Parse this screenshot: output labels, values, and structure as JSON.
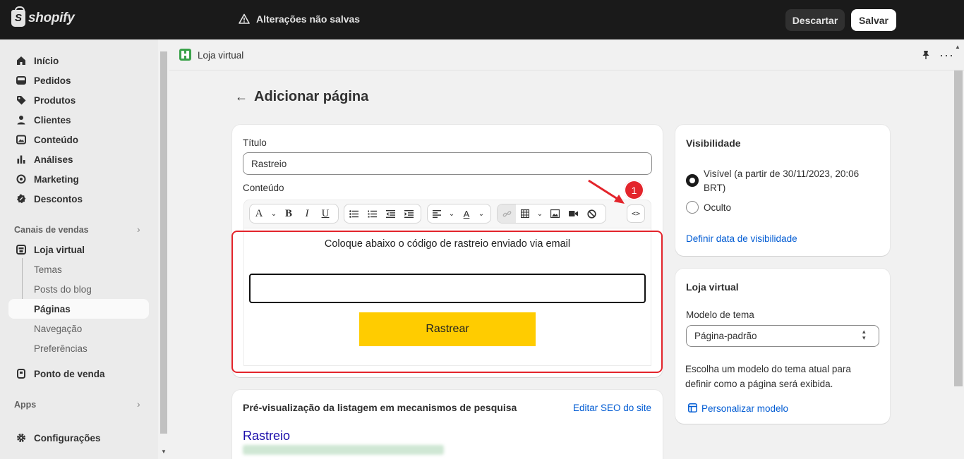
{
  "topbar": {
    "logo_text": "shopify",
    "unsaved_text": "Alterações não salvas",
    "discard_label": "Descartar",
    "save_label": "Salvar",
    "bg_color": "#1a1a1a"
  },
  "sidebar": {
    "items": [
      {
        "label": "Início",
        "icon": "home-icon"
      },
      {
        "label": "Pedidos",
        "icon": "inbox-icon"
      },
      {
        "label": "Produtos",
        "icon": "tag-icon"
      },
      {
        "label": "Clientes",
        "icon": "person-icon"
      },
      {
        "label": "Conteúdo",
        "icon": "image-icon"
      },
      {
        "label": "Análises",
        "icon": "bar-chart-icon"
      },
      {
        "label": "Marketing",
        "icon": "target-icon"
      },
      {
        "label": "Descontos",
        "icon": "discount-icon"
      }
    ],
    "sales_channels_label": "Canais de vendas",
    "store_label": "Loja virtual",
    "store_subitems": [
      "Temas",
      "Posts do blog",
      "Páginas",
      "Navegação",
      "Preferências"
    ],
    "active_subitem": "Páginas",
    "pos_label": "Ponto de venda",
    "apps_label": "Apps",
    "settings_label": "Configurações"
  },
  "breadcrumb": {
    "store_name": "Loja virtual"
  },
  "page": {
    "title": "Adicionar página"
  },
  "content_card": {
    "title_label": "Título",
    "title_value": "Rastreio",
    "content_label": "Conteúdo",
    "editor_caption": "Coloque abaixo o código de rastreio enviado via email",
    "track_button": "Rastrear",
    "track_button_color": "#ffcc00",
    "code_button": "<>",
    "annotation_number": "1",
    "annotation_color": "#e3242b"
  },
  "toolbar": {
    "font": "A",
    "bold": "B",
    "italic": "I",
    "underline": "U",
    "text_color": "A"
  },
  "seo_card": {
    "title": "Pré-visualização da listagem em mecanismos de pesquisa",
    "edit_link": "Editar SEO do site",
    "preview_title": "Rastreio"
  },
  "visibility_card": {
    "title": "Visibilidade",
    "option_visible": "Visível (a partir de 30/11/2023, 20:06 BRT)",
    "option_hidden": "Oculto",
    "selected": "Visível",
    "set_date_link": "Definir data de visibilidade"
  },
  "store_card": {
    "title": "Loja virtual",
    "template_label": "Modelo de tema",
    "template_value": "Página-padrão",
    "help_text": "Escolha um modelo do tema atual para definir como a página será exibida.",
    "customize_link": "Personalizar modelo"
  }
}
